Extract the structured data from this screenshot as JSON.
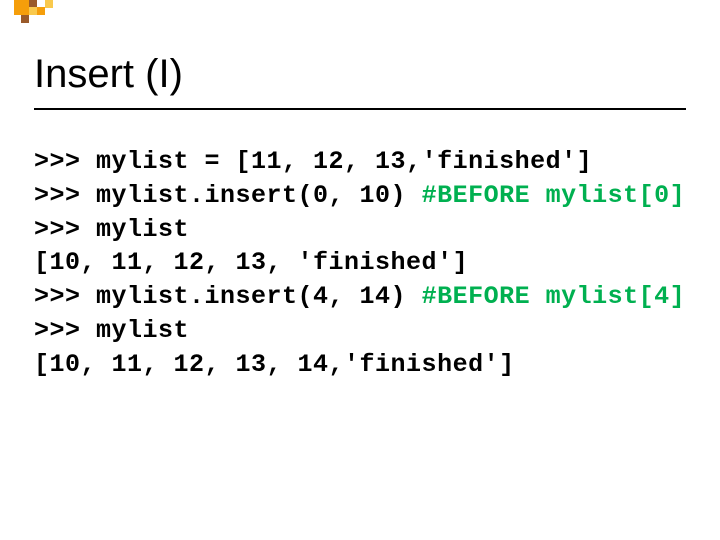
{
  "title": "Insert (I)",
  "code": {
    "line1_prompt": ">>> ",
    "line1_code": "mylist = [11, 12, 13,'finished']",
    "line2_prompt": ">>> ",
    "line2_code": "mylist.insert(0, 10) ",
    "line2_comment": "#BEFORE mylist[0]",
    "line3_prompt": ">>> ",
    "line3_code": "mylist",
    "line4": "[10, 11, 12, 13, 'finished']",
    "line5_prompt": ">>> ",
    "line5_code": "mylist.insert(4, 14) ",
    "line5_comment": "#BEFORE mylist[4]",
    "line6_prompt": ">>> ",
    "line6_code": "mylist",
    "line7": "[10, 11, 12, 13, 14,'finished']"
  },
  "colors": {
    "orange": "#f59e0b",
    "brown": "#9a5a2a",
    "yellow": "#f9c94d"
  }
}
